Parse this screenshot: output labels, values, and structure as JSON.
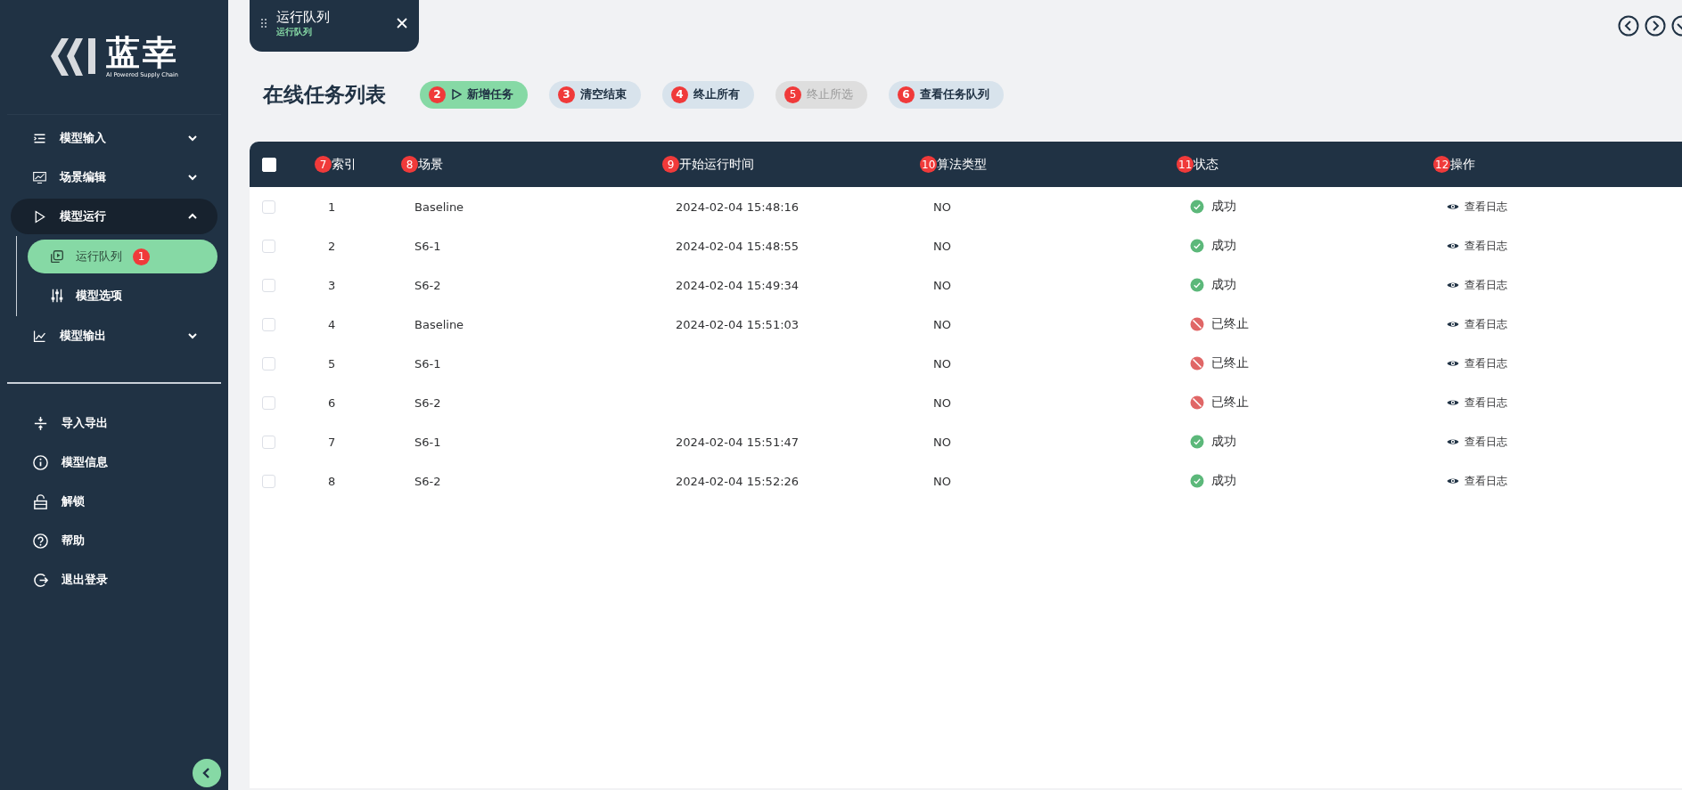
{
  "sidebar": {
    "logo": {
      "name": "蓝幸",
      "tagline": "AI Powered Supply Chain"
    },
    "menu": [
      {
        "label": "模型输入",
        "kind": "list",
        "expanded": false
      },
      {
        "label": "场景编辑",
        "kind": "monitor",
        "expanded": false
      },
      {
        "label": "模型运行",
        "kind": "play",
        "expanded": true,
        "children": [
          {
            "label": "运行队列",
            "kind": "queue",
            "selected": true,
            "marker": "1"
          },
          {
            "label": "模型选项",
            "kind": "sliders",
            "selected": false
          }
        ]
      },
      {
        "label": "模型输出",
        "kind": "chart",
        "expanded": false
      }
    ],
    "actions": [
      {
        "label": "导入导出",
        "kind": "import"
      },
      {
        "label": "模型信息",
        "kind": "info"
      },
      {
        "label": "解锁",
        "kind": "unlock"
      },
      {
        "label": "帮助",
        "kind": "help"
      },
      {
        "label": "退出登录",
        "kind": "logout"
      }
    ]
  },
  "tab": {
    "title": "运行队列",
    "subtitle": "运行队列"
  },
  "page_title": "在线任务列表",
  "toolbar": [
    {
      "label": "新增任务",
      "marker": "2",
      "kind": "primary",
      "disabled": false
    },
    {
      "label": "清空结束",
      "marker": "3",
      "kind": "secondary",
      "disabled": false
    },
    {
      "label": "终止所有",
      "marker": "4",
      "kind": "secondary",
      "disabled": false
    },
    {
      "label": "终止所选",
      "marker": "5",
      "kind": "secondary",
      "disabled": true
    },
    {
      "label": "查看任务队列",
      "marker": "6",
      "kind": "secondary",
      "disabled": false
    }
  ],
  "table": {
    "select_all": {
      "checked": false
    },
    "columns": [
      {
        "label": "索引",
        "marker": "7"
      },
      {
        "label": "场景",
        "marker": "8"
      },
      {
        "label": "开始运行时间",
        "marker": "9"
      },
      {
        "label": "算法类型",
        "marker": "10"
      },
      {
        "label": "状态",
        "marker": "11"
      },
      {
        "label": "操作",
        "marker": "12"
      }
    ],
    "rows": [
      {
        "checked": false,
        "index": "1",
        "scene": "Baseline",
        "start_time": "2024-02-04 15:48:16",
        "algorithm": "NO",
        "status": {
          "kind": "success",
          "label": "成功"
        },
        "action": "查看日志"
      },
      {
        "checked": false,
        "index": "2",
        "scene": "S6-1",
        "start_time": "2024-02-04 15:48:55",
        "algorithm": "NO",
        "status": {
          "kind": "success",
          "label": "成功"
        },
        "action": "查看日志"
      },
      {
        "checked": false,
        "index": "3",
        "scene": "S6-2",
        "start_time": "2024-02-04 15:49:34",
        "algorithm": "NO",
        "status": {
          "kind": "success",
          "label": "成功"
        },
        "action": "查看日志"
      },
      {
        "checked": false,
        "index": "4",
        "scene": "Baseline",
        "start_time": "2024-02-04 15:51:03",
        "algorithm": "NO",
        "status": {
          "kind": "stopped",
          "label": "已终止"
        },
        "action": "查看日志"
      },
      {
        "checked": false,
        "index": "5",
        "scene": "S6-1",
        "algorithm": "NO",
        "status": {
          "kind": "stopped",
          "label": "已终止"
        },
        "action": "查看日志"
      },
      {
        "checked": false,
        "index": "6",
        "scene": "S6-2",
        "algorithm": "NO",
        "status": {
          "kind": "stopped",
          "label": "已终止"
        },
        "action": "查看日志"
      },
      {
        "checked": false,
        "index": "7",
        "scene": "S6-1",
        "start_time": "2024-02-04 15:51:47",
        "algorithm": "NO",
        "status": {
          "kind": "success",
          "label": "成功"
        },
        "action": "查看日志"
      },
      {
        "checked": false,
        "index": "8",
        "scene": "S6-2",
        "start_time": "2024-02-04 15:52:26",
        "algorithm": "NO",
        "status": {
          "kind": "success",
          "label": "成功"
        },
        "action": "查看日志"
      }
    ]
  }
}
